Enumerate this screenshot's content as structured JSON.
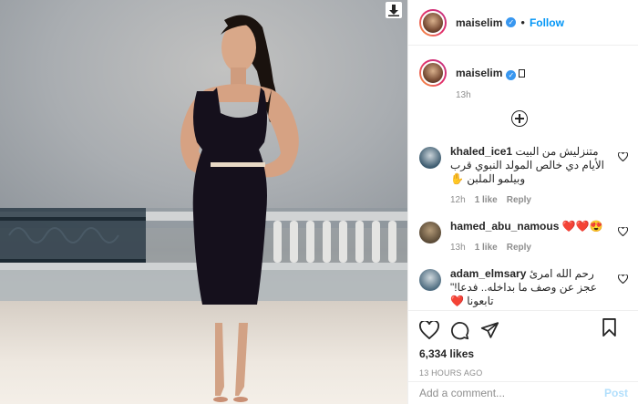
{
  "colors": {
    "accent": "#0095f6",
    "verified": "#3897f0",
    "heart": "#ed4956"
  },
  "post": {
    "username": "maiselim",
    "follow_label": "Follow",
    "separator": "•",
    "caption_time": "13h",
    "likes": "6,334 likes",
    "time_ago": "13 HOURS AGO"
  },
  "comments": [
    {
      "user": "khaled_ice1",
      "text": "متنزليش من البيت الأيام دي خالص المولد النبوي قرب وبيلمو الملبن ✋",
      "time": "12h",
      "likes": "1 like",
      "reply": "Reply"
    },
    {
      "user": "hamed_abu_namous",
      "text": "❤️❤️😍",
      "time": "13h",
      "likes": "1 like",
      "reply": "Reply"
    },
    {
      "user": "adam_elmsary",
      "text": "رحم الله امرئ عجز عن وصف ما بداخله.. فدعا!\" تابعونا ❤️",
      "time": "",
      "likes": "",
      "reply": ""
    }
  ],
  "add_comment": {
    "placeholder": "Add a comment...",
    "post_label": "Post"
  },
  "icons": [
    "download-icon",
    "verified-icon",
    "add-comments-icon",
    "heart-icon",
    "comment-icon",
    "share-icon",
    "bookmark-icon"
  ]
}
